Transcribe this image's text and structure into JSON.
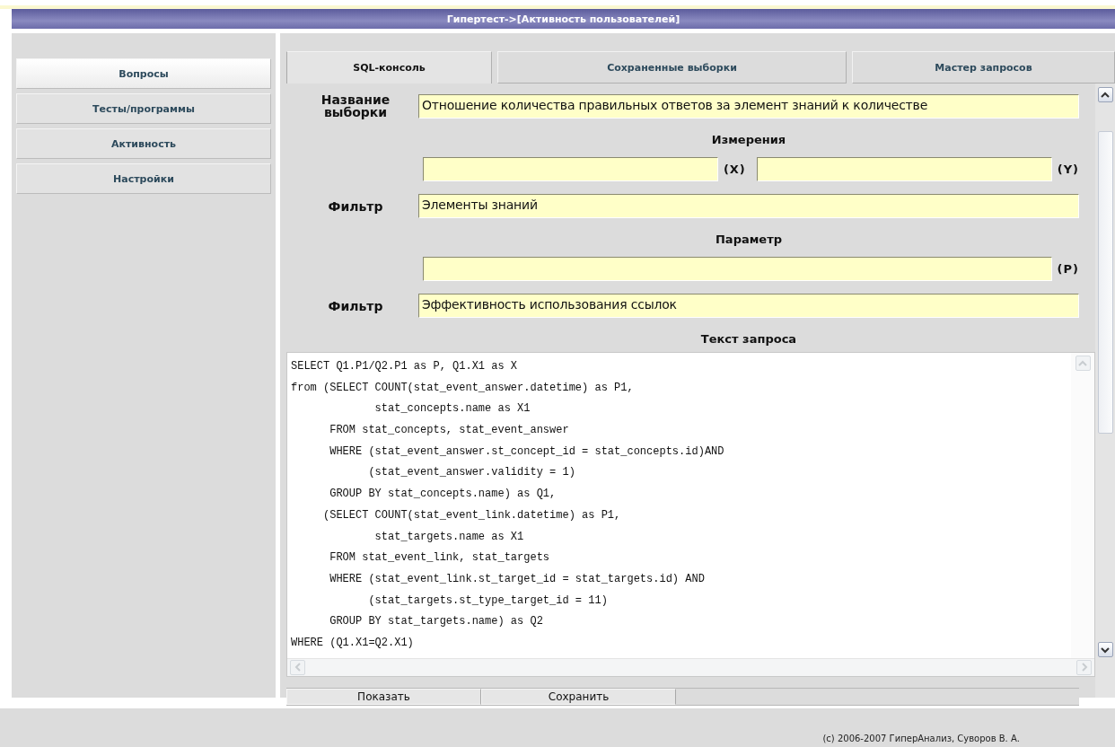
{
  "window": {
    "title": "Гипертест->[Активность пользователей]"
  },
  "sidebar": {
    "items": [
      {
        "label": "Вопросы",
        "selected": true
      },
      {
        "label": "Тесты/программы",
        "selected": false
      },
      {
        "label": "Активность",
        "selected": false
      },
      {
        "label": "Настройки",
        "selected": false
      }
    ]
  },
  "tabs": [
    {
      "label": "SQL-консоль",
      "selected": true
    },
    {
      "label": "Сохраненные выборки",
      "selected": false
    },
    {
      "label": "Мастер запросов",
      "selected": false
    }
  ],
  "form": [
    {
      "kind": "field",
      "label": "Название выборки",
      "value": "Отношение количества правильных ответов  за элемент знаний к количестве"
    },
    {
      "kind": "heading",
      "label": "Измерения"
    },
    {
      "kind": "pair",
      "suffixes": [
        "(X)",
        "(Y)"
      ]
    },
    {
      "kind": "field",
      "label": "Фильтр",
      "value": "Элементы знаний"
    },
    {
      "kind": "heading",
      "label": "Параметр"
    },
    {
      "kind": "single",
      "suffix": "(P)"
    },
    {
      "kind": "field",
      "label": "Фильтр",
      "value": "Эффективность использования ссылок"
    },
    {
      "kind": "heading",
      "label": "Текст запроса"
    }
  ],
  "query": {
    "lines": [
      "SELECT Q1.P1/Q2.P1 as P, Q1.X1 as X",
      "from (SELECT COUNT(stat_event_answer.datetime) as P1,",
      "             stat_concepts.name as X1",
      "      FROM stat_concepts, stat_event_answer",
      "      WHERE (stat_event_answer.st_concept_id = stat_concepts.id)AND",
      "            (stat_event_answer.validity = 1)",
      "      GROUP BY stat_concepts.name) as Q1,",
      "     (SELECT COUNT(stat_event_link.datetime) as P1,",
      "             stat_targets.name as X1",
      "      FROM stat_event_link, stat_targets",
      "      WHERE (stat_event_link.st_target_id = stat_targets.id) AND",
      "            (stat_targets.st_type_target_id = 11)",
      "      GROUP BY stat_targets.name) as Q2",
      "WHERE (Q1.X1=Q2.X1)"
    ]
  },
  "buttons": [
    "Показать",
    "Сохранить"
  ],
  "footer": "(c) 2006-2007 ГиперАнализ, Суворов В. А."
}
